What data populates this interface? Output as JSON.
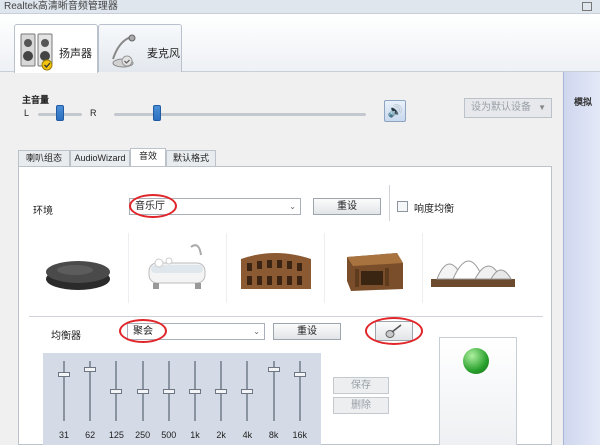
{
  "window": {
    "title": "Realtek高清晰音频管理器"
  },
  "device_tabs": [
    {
      "label": "扬声器",
      "icon": "speaker-icon",
      "active": true
    },
    {
      "label": "麦克风",
      "icon": "microphone-icon",
      "active": false
    }
  ],
  "master_volume": {
    "label": "主音量",
    "left_label": "L",
    "right_label": "R",
    "balance": 0.5,
    "level": 0.17,
    "mute_icon": "speaker-volume-icon"
  },
  "default_device": {
    "label": "设为默认设备"
  },
  "side_panel": {
    "label": "模拟"
  },
  "sub_tabs": [
    {
      "label": "喇叭组态",
      "active": false
    },
    {
      "label": "AudioWizard",
      "active": false
    },
    {
      "label": "音效",
      "active": true
    },
    {
      "label": "默认格式",
      "active": false
    }
  ],
  "environment": {
    "label": "环境",
    "selected": "音乐厅",
    "reset_label": "重设",
    "loudness_label": "响度均衡",
    "loudness_checked": false,
    "thumbnails": [
      {
        "icon": "stone-disc-icon"
      },
      {
        "icon": "bathtub-icon"
      },
      {
        "icon": "colosseum-icon"
      },
      {
        "icon": "arena-icon"
      },
      {
        "icon": "opera-house-icon"
      }
    ]
  },
  "equalizer": {
    "label": "均衡器",
    "selected": "聚会",
    "reset_label": "重设",
    "guitar_icon": "guitar-icon",
    "save_label": "保存",
    "delete_label": "删除",
    "bands": [
      {
        "freq": "31",
        "level": 0.2
      },
      {
        "freq": "62",
        "level": 0.1
      },
      {
        "freq": "125",
        "level": 0.5
      },
      {
        "freq": "250",
        "level": 0.5
      },
      {
        "freq": "500",
        "level": 0.5
      },
      {
        "freq": "1k",
        "level": 0.5
      },
      {
        "freq": "2k",
        "level": 0.5
      },
      {
        "freq": "4k",
        "level": 0.5
      },
      {
        "freq": "8k",
        "level": 0.1
      },
      {
        "freq": "16k",
        "level": 0.2
      }
    ]
  },
  "colors": {
    "highlight_oval": "#e0262a",
    "slider_thumb": "#2d6fc0",
    "eq_background": "#d4dbe6",
    "side_panel": "#cfd7ef"
  }
}
